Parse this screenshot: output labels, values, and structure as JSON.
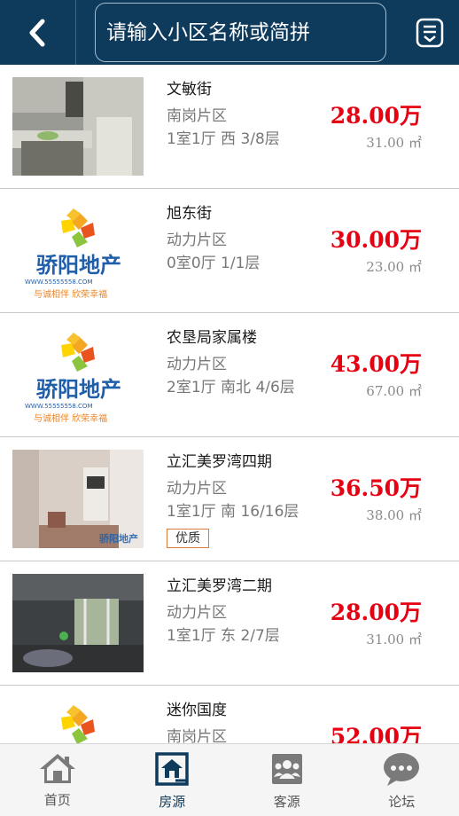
{
  "header": {
    "search_placeholder": "请输入小区名称或简拼"
  },
  "listings": [
    {
      "title": "文敏街",
      "district": "南岗片区",
      "spec": "1室1厅  西  3/8层",
      "price": "28.00万",
      "area": "31.00 ㎡",
      "thumb": "photo-kitchen",
      "badge": ""
    },
    {
      "title": "旭东街",
      "district": "动力片区",
      "spec": "0室0厅    1/1层",
      "price": "30.00万",
      "area": "23.00 ㎡",
      "thumb": "logo",
      "badge": ""
    },
    {
      "title": "农垦局家属楼",
      "district": "动力片区",
      "spec": "2室1厅  南北  4/6层",
      "price": "43.00万",
      "area": "67.00 ㎡",
      "thumb": "logo",
      "badge": ""
    },
    {
      "title": "立汇美罗湾四期",
      "district": "动力片区",
      "spec": "1室1厅  南  16/16层",
      "price": "36.50万",
      "area": "38.00 ㎡",
      "thumb": "photo-living",
      "badge": "优质"
    },
    {
      "title": "立汇美罗湾二期",
      "district": "动力片区",
      "spec": "1室1厅  东  2/7层",
      "price": "28.00万",
      "area": "31.00 ㎡",
      "thumb": "photo-room",
      "badge": ""
    },
    {
      "title": "迷你国度",
      "district": "南岗片区",
      "spec": "",
      "price": "52.00万",
      "area": "",
      "thumb": "logo",
      "badge": ""
    }
  ],
  "logo": {
    "brand": "骄阳地产",
    "url": "WWW.55555558.COM",
    "slogan": "与诚相伴  欣荣幸福"
  },
  "watermark": "骄阳地产",
  "tabs": [
    {
      "label": "首页",
      "icon": "home-icon",
      "active": false
    },
    {
      "label": "房源",
      "icon": "listing-icon",
      "active": true
    },
    {
      "label": "客源",
      "icon": "clients-icon",
      "active": false
    },
    {
      "label": "论坛",
      "icon": "forum-icon",
      "active": false
    }
  ],
  "colors": {
    "header_bg": "#0e3a5c",
    "price": "#e60012",
    "badge_border": "#e07a3a"
  }
}
